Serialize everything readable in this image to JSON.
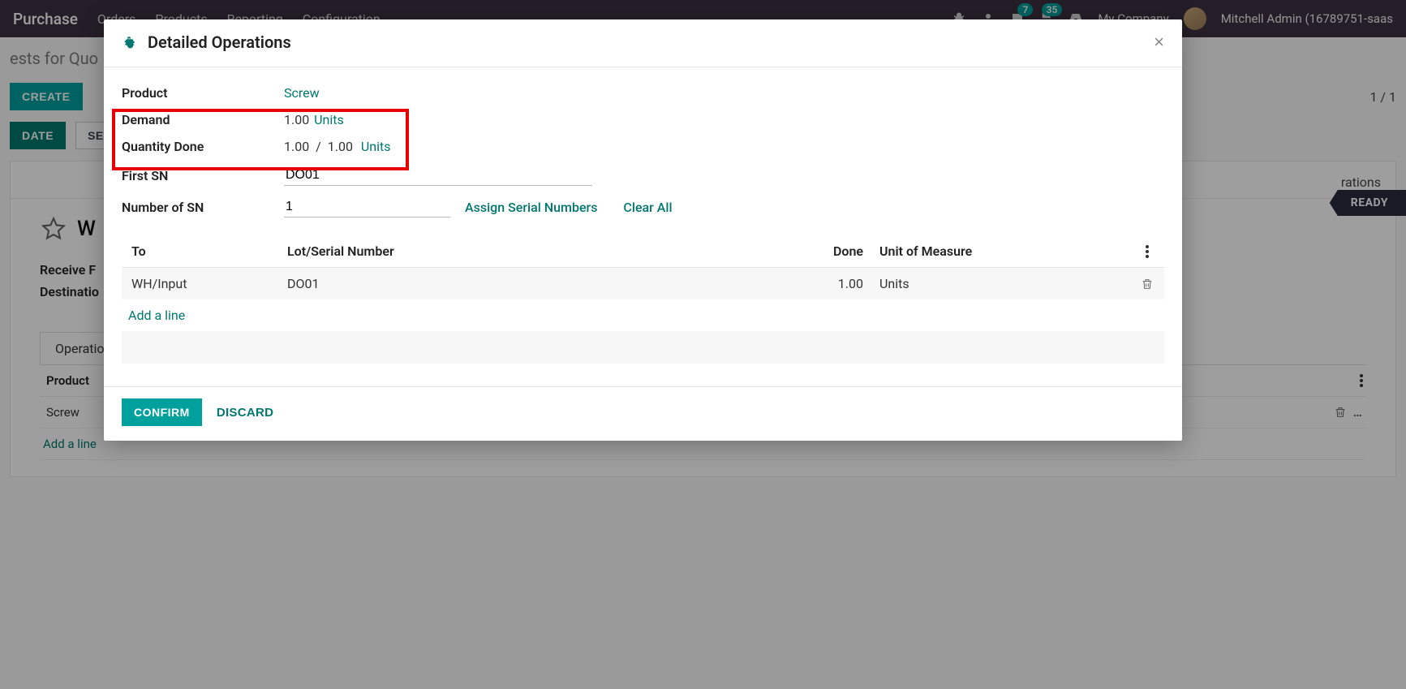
{
  "navbar": {
    "app": "Purchase",
    "menus": [
      "Orders",
      "Products",
      "Reporting",
      "Configuration"
    ],
    "msg_badge": "7",
    "act_badge": "35",
    "company": "My Company",
    "user": "Mitchell Admin (16789751-saas"
  },
  "page": {
    "breadcrumb": "ests for Quo",
    "create": "CREATE",
    "counter": "1 / 1",
    "btn_date": "DATE",
    "btn_setqu": "SET QU",
    "status": "READY",
    "link_operations": "rations",
    "receipt_title": "W",
    "receive_label": "Receive F",
    "dest_label": "Destinatio",
    "tab_operations": "Operatio",
    "col_product": "Product",
    "row_product": "Screw",
    "add_line": "Add a line"
  },
  "modal": {
    "title": "Detailed Operations",
    "labels": {
      "product": "Product",
      "demand": "Demand",
      "qty_done": "Quantity Done",
      "first_sn": "First SN",
      "num_sn": "Number of SN",
      "to": "To",
      "lot": "Lot/Serial Number",
      "done": "Done",
      "uom": "Unit of Measure"
    },
    "values": {
      "product": "Screw",
      "demand_qty": "1.00",
      "demand_units": "Units",
      "qty_done_a": "1.00",
      "qty_done_sep": "/",
      "qty_done_b": "1.00",
      "qty_done_units": "Units",
      "first_sn": "DO01",
      "num_sn": "1"
    },
    "actions": {
      "assign": "Assign Serial Numbers",
      "clear": "Clear All"
    },
    "row": {
      "to": "WH/Input",
      "lot": "DO01",
      "done": "1.00",
      "uom": "Units"
    },
    "add_line": "Add a line",
    "confirm": "CONFIRM",
    "discard": "DISCARD"
  }
}
